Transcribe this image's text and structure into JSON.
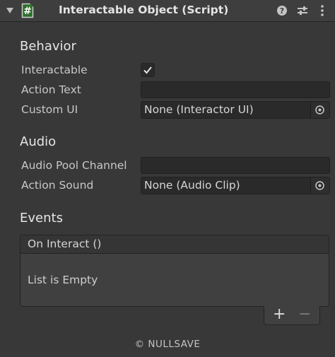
{
  "header": {
    "title": "Interactable Object (Script)",
    "script_icon_glyph": "#",
    "buttons": [
      "help-icon",
      "presets-icon",
      "context-menu-icon"
    ]
  },
  "behavior": {
    "title": "Behavior",
    "interactable": {
      "label": "Interactable",
      "checked": true
    },
    "action_text": {
      "label": "Action Text",
      "value": ""
    },
    "custom_ui": {
      "label": "Custom UI",
      "value": "None (Interactor UI)"
    }
  },
  "audio": {
    "title": "Audio",
    "audio_pool_channel": {
      "label": "Audio Pool Channel",
      "value": ""
    },
    "action_sound": {
      "label": "Action Sound",
      "value": "None (Audio Clip)"
    }
  },
  "events": {
    "title": "Events",
    "on_interact": {
      "label": "On Interact ()",
      "empty_text": "List is Empty"
    },
    "add_label": "+",
    "remove_label": "−"
  },
  "footer": {
    "text": "© NULLSAVE"
  },
  "colors": {
    "background": "#383838",
    "header": "#3e3e3e",
    "field": "#2a2a2a",
    "script_icon_green": "#8ac84c"
  }
}
